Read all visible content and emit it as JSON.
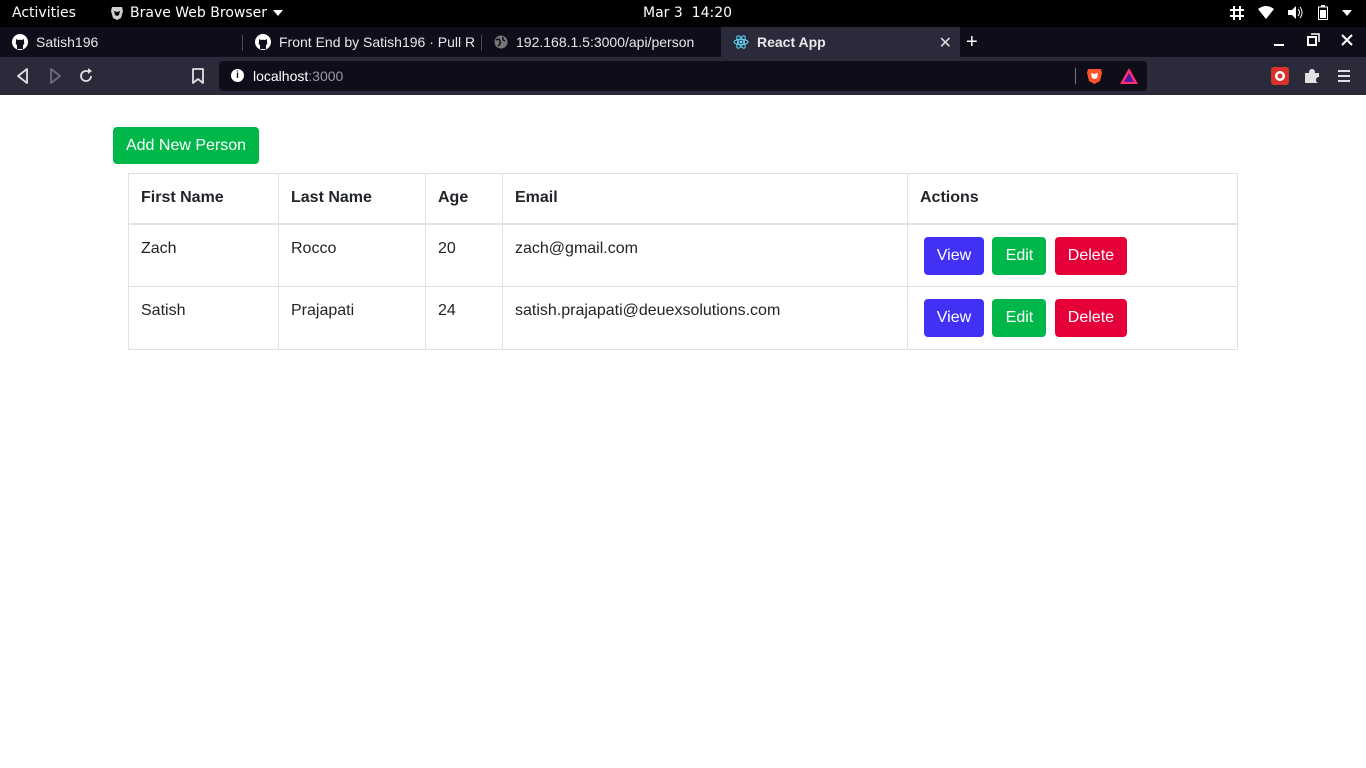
{
  "system_bar": {
    "activities": "Activities",
    "app_name": "Brave Web Browser",
    "clock": "Mar 3  14:20"
  },
  "tabs": [
    {
      "title": "Satish196",
      "icon": "github-icon"
    },
    {
      "title": "Front End by Satish196 · Pull R",
      "icon": "github-icon"
    },
    {
      "title": "192.168.1.5:3000/api/person",
      "icon": "globe-icon"
    },
    {
      "title": "React App",
      "icon": "react-icon",
      "active": true
    }
  ],
  "address_bar": {
    "host": "localhost",
    "port": ":3000"
  },
  "page": {
    "add_button": "Add New Person",
    "columns": [
      "First Name",
      "Last Name",
      "Age",
      "Email",
      "Actions"
    ],
    "rows": [
      {
        "first_name": "Zach",
        "last_name": "Rocco",
        "age": "20",
        "email": "zach@gmail.com"
      },
      {
        "first_name": "Satish",
        "last_name": "Prajapati",
        "age": "24",
        "email": "satish.prajapati@deuexsolutions.com"
      }
    ],
    "actions": {
      "view": "View",
      "edit": "Edit",
      "delete": "Delete"
    }
  },
  "colors": {
    "add": "#00b849",
    "view": "#4131f5",
    "edit": "#00b849",
    "delete": "#e6003a"
  }
}
